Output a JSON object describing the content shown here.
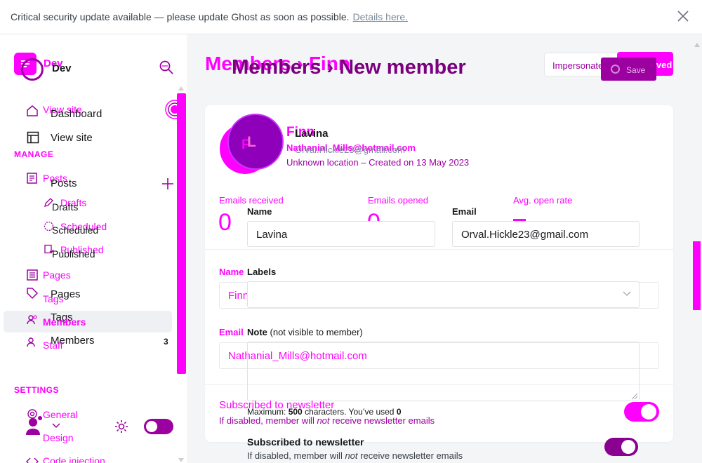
{
  "banner": {
    "message": "Critical security update available — please update Ghost as soon as possible.",
    "link": "Details here."
  },
  "sidebar": {
    "brand_ghost": "Dev",
    "brand": "Dev",
    "ghost_items": [
      "View site",
      "Posts",
      "Drafts",
      "Scheduled",
      "Published",
      "Pages",
      "Tags",
      "Members",
      "Staff",
      "General",
      "Design",
      "Code injection"
    ],
    "items": {
      "dashboard": "Dashboard",
      "view_site": "View site",
      "posts": "Posts",
      "drafts": "Drafts",
      "scheduled": "Scheduled",
      "published": "Published",
      "pages": "Pages",
      "tags": "Tags",
      "members": "Members",
      "members_count": "3"
    },
    "sections": {
      "manage": "MANAGE",
      "settings": "SETTINGS"
    }
  },
  "header": {
    "ghost_title": "Members › Finn",
    "title": "Members › New member",
    "impersonate": "Impersonate",
    "saved": "Saved",
    "save": "Save"
  },
  "member_ghost": {
    "initial": "F",
    "name": "Finn",
    "email": "Nathanial_Mills@hotmail.com",
    "meta": "Unknown location – Created on 13 May 2023"
  },
  "member": {
    "initial": "L",
    "name": "Lavina",
    "email": "Orval.Hickle23@gmail.com"
  },
  "stats": {
    "emails_received_label": "Emails received",
    "emails_received": "0",
    "emails_opened_label": "Emails opened",
    "emails_opened": "0",
    "open_rate_label": "Avg. open rate"
  },
  "form": {
    "name_label": "Name",
    "name_value": "Lavina",
    "email_label": "Email",
    "email_value": "Orval.Hickle23@gmail.com",
    "labels_label": "Labels",
    "note_label": "Note",
    "note_hint": "(not visible to member)",
    "ghost_name_label": "Name",
    "ghost_name_value": "Finn",
    "ghost_email_label": "Email",
    "ghost_email_value": "Nathanial_Mills@hotmail.com",
    "max_chars_prefix": "Maximum:",
    "max_chars_num": "500",
    "max_chars_suffix": "characters. You’ve used",
    "max_chars_used": "0"
  },
  "newsletter": {
    "ghost_title": "Subscribed to newsletter",
    "ghost_desc_before": "If disabled, member will",
    "ghost_desc_em": "not",
    "ghost_desc_after": "receive newsletter emails",
    "title": "Subscribed to newsletter",
    "desc_before": "If disabled, member will",
    "desc_em": "not",
    "desc_after": "receive newsletter emails",
    "subscribed": true
  },
  "colors": {
    "accent": "#ff00ff",
    "accent_dark": "#9c00a0",
    "active_bg": "#eef0f3"
  }
}
